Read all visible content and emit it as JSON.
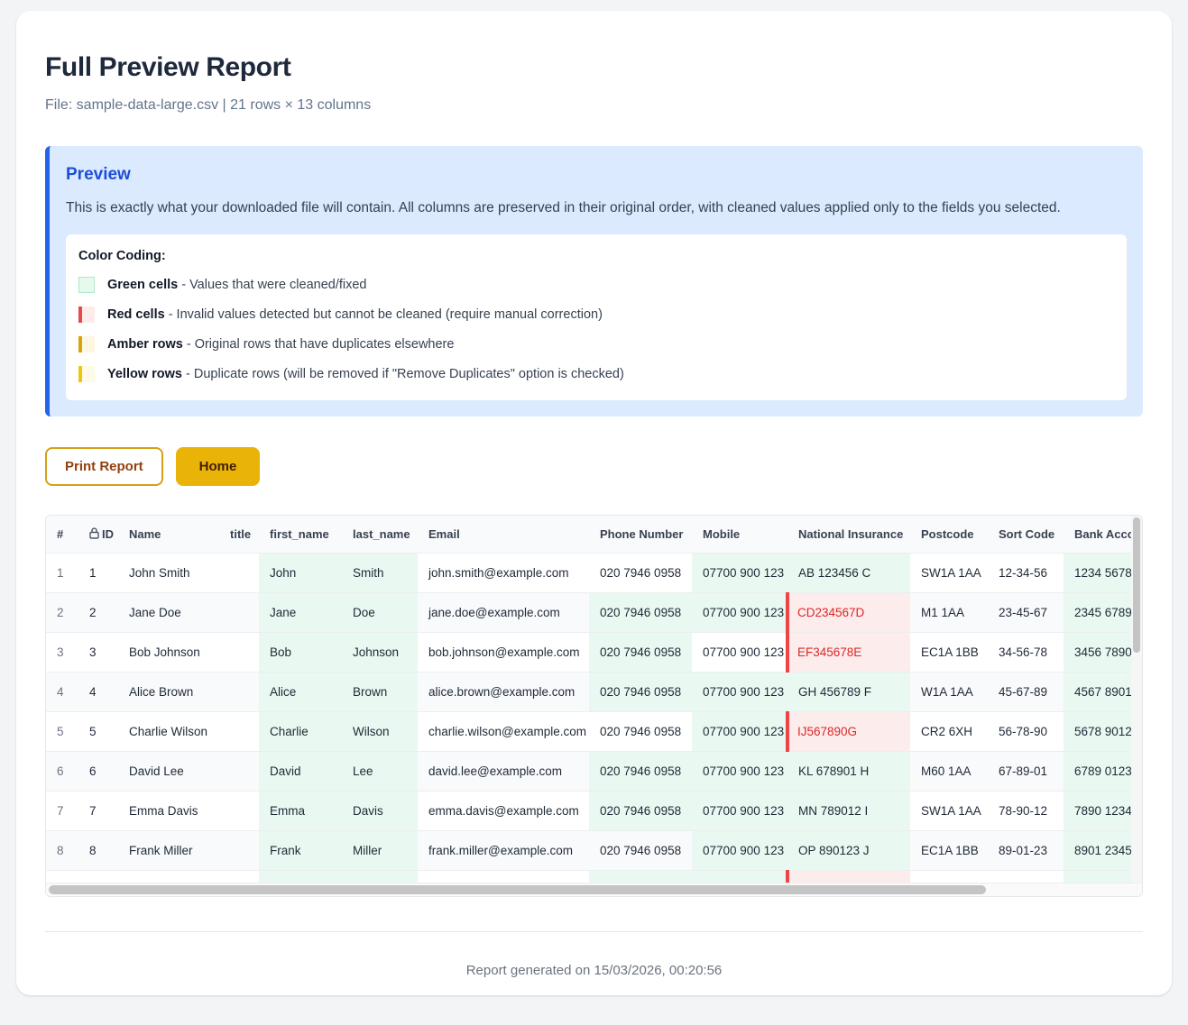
{
  "page": {
    "title": "Full Preview Report",
    "subtitle": "File: sample-data-large.csv | 21 rows × 13 columns"
  },
  "preview": {
    "heading": "Preview",
    "description": "This is exactly what your downloaded file will contain. All columns are preserved in their original order, with cleaned values applied only to the fields you selected.",
    "legend_title": "Color Coding:",
    "legend": [
      {
        "type": "green",
        "label": "Green cells",
        "desc": "- Values that were cleaned/fixed"
      },
      {
        "type": "red",
        "label": "Red cells",
        "desc": "- Invalid values detected but cannot be cleaned (require manual correction)"
      },
      {
        "type": "amber",
        "label": "Amber rows",
        "desc": "- Original rows that have duplicates elsewhere"
      },
      {
        "type": "yellow",
        "label": "Yellow rows",
        "desc": "- Duplicate rows (will be removed if \"Remove Duplicates\" option is checked)"
      }
    ]
  },
  "actions": {
    "print_label": "Print Report",
    "home_label": "Home"
  },
  "table": {
    "columns": [
      {
        "key": "num",
        "label": "#"
      },
      {
        "key": "id",
        "label": "ID",
        "lock": true
      },
      {
        "key": "name",
        "label": "Name"
      },
      {
        "key": "title",
        "label": "title"
      },
      {
        "key": "first",
        "label": "first_name"
      },
      {
        "key": "last",
        "label": "last_name"
      },
      {
        "key": "email",
        "label": "Email"
      },
      {
        "key": "phone",
        "label": "Phone Number"
      },
      {
        "key": "mobile",
        "label": "Mobile"
      },
      {
        "key": "ni",
        "label": "National Insurance"
      },
      {
        "key": "postcode",
        "label": "Postcode"
      },
      {
        "key": "sort",
        "label": "Sort Code"
      },
      {
        "key": "bank",
        "label": "Bank Acco"
      }
    ],
    "rows": [
      {
        "num": "1",
        "id": "1",
        "name": "John Smith",
        "title": "",
        "first": "John",
        "last": "Smith",
        "email": "john.smith@example.com",
        "phone": "020 7946 0958",
        "mobile": "07700 900 123",
        "ni": "AB 123456 C",
        "postcode": "SW1A 1AA",
        "sort": "12-34-56",
        "bank": "1234 5678",
        "cleaned": [
          "first",
          "last",
          "mobile",
          "ni",
          "bank"
        ],
        "invalid": []
      },
      {
        "num": "2",
        "id": "2",
        "name": "Jane Doe",
        "title": "",
        "first": "Jane",
        "last": "Doe",
        "email": "jane.doe@example.com",
        "phone": "020 7946 0958",
        "mobile": "07700 900 123",
        "ni": "CD234567D",
        "postcode": "M1 1AA",
        "sort": "23-45-67",
        "bank": "2345 6789",
        "cleaned": [
          "first",
          "last",
          "phone",
          "mobile",
          "bank"
        ],
        "invalid": [
          "ni"
        ]
      },
      {
        "num": "3",
        "id": "3",
        "name": "Bob Johnson",
        "title": "",
        "first": "Bob",
        "last": "Johnson",
        "email": "bob.johnson@example.com",
        "phone": "020 7946 0958",
        "mobile": "07700 900 123",
        "ni": "EF345678E",
        "postcode": "EC1A 1BB",
        "sort": "34-56-78",
        "bank": "3456 7890",
        "cleaned": [
          "first",
          "last",
          "phone",
          "bank"
        ],
        "invalid": [
          "ni"
        ]
      },
      {
        "num": "4",
        "id": "4",
        "name": "Alice Brown",
        "title": "",
        "first": "Alice",
        "last": "Brown",
        "email": "alice.brown@example.com",
        "phone": "020 7946 0958",
        "mobile": "07700 900 123",
        "ni": "GH 456789 F",
        "postcode": "W1A 1AA",
        "sort": "45-67-89",
        "bank": "4567 8901",
        "cleaned": [
          "first",
          "last",
          "phone",
          "mobile",
          "ni",
          "bank"
        ],
        "invalid": []
      },
      {
        "num": "5",
        "id": "5",
        "name": "Charlie Wilson",
        "title": "",
        "first": "Charlie",
        "last": "Wilson",
        "email": "charlie.wilson@example.com",
        "phone": "020 7946 0958",
        "mobile": "07700 900 123",
        "ni": "IJ567890G",
        "postcode": "CR2 6XH",
        "sort": "56-78-90",
        "bank": "5678 9012",
        "cleaned": [
          "first",
          "last",
          "mobile",
          "bank"
        ],
        "invalid": [
          "ni"
        ]
      },
      {
        "num": "6",
        "id": "6",
        "name": "David Lee",
        "title": "",
        "first": "David",
        "last": "Lee",
        "email": "david.lee@example.com",
        "phone": "020 7946 0958",
        "mobile": "07700 900 123",
        "ni": "KL 678901 H",
        "postcode": "M60 1AA",
        "sort": "67-89-01",
        "bank": "6789 0123",
        "cleaned": [
          "first",
          "last",
          "phone",
          "mobile",
          "ni",
          "bank"
        ],
        "invalid": []
      },
      {
        "num": "7",
        "id": "7",
        "name": "Emma Davis",
        "title": "",
        "first": "Emma",
        "last": "Davis",
        "email": "emma.davis@example.com",
        "phone": "020 7946 0958",
        "mobile": "07700 900 123",
        "ni": "MN 789012 I",
        "postcode": "SW1A 1AA",
        "sort": "78-90-12",
        "bank": "7890 1234",
        "cleaned": [
          "first",
          "last",
          "phone",
          "mobile",
          "ni",
          "bank"
        ],
        "invalid": []
      },
      {
        "num": "8",
        "id": "8",
        "name": "Frank Miller",
        "title": "",
        "first": "Frank",
        "last": "Miller",
        "email": "frank.miller@example.com",
        "phone": "020 7946 0958",
        "mobile": "07700 900 123",
        "ni": "OP 890123 J",
        "postcode": "EC1A 1BB",
        "sort": "89-01-23",
        "bank": "8901 2345",
        "cleaned": [
          "first",
          "last",
          "mobile",
          "ni",
          "bank"
        ],
        "invalid": []
      }
    ],
    "partial_row": {
      "cleaned": [
        "first",
        "last",
        "phone",
        "mobile",
        "bank"
      ],
      "invalid": [
        "ni"
      ]
    }
  },
  "colors": {
    "accent_blue": "#2563eb",
    "heading_blue": "#1d4ed8",
    "green_cell": "#e9f8f0",
    "red_cell_bg": "#fdecec",
    "red_border": "#ef4444",
    "red_text": "#dc2626",
    "amber_border": "#d9a406",
    "yellow_border": "#eec70a",
    "button_gold": "#eab308",
    "print_text_brown": "#92400e"
  },
  "footer": {
    "text": "Report generated on 15/03/2026, 00:20:56"
  }
}
